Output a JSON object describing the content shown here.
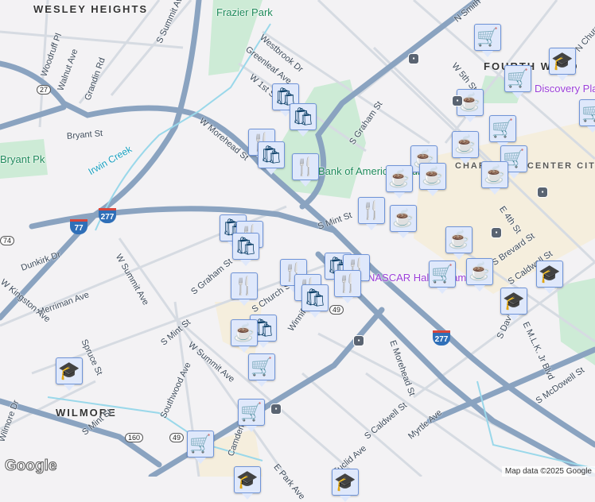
{
  "areas": {
    "wesley_heights": "WESLEY HEIGHTS",
    "wilmore": "WILMORE",
    "fourth_ward": "FOURTH WARD",
    "center_city": "CHARLOTTE CENTER CITY"
  },
  "parks": {
    "frazier": "Frazier Park",
    "bryant": "Bryant Pk",
    "bank_of_america": "Bank of America Stadium"
  },
  "pois": {
    "discovery": "Discovery Place",
    "nascar": "NASCAR Hall of Fame"
  },
  "water": {
    "irwin_creek": "Irwin Creek"
  },
  "streets": [
    "Woodruff Pl",
    "Walnut Ave",
    "Grandin Rd",
    "S Summit Ave",
    "Westbrook Dr",
    "Greenleaf Ave",
    "W 1st St",
    "W Morehead St",
    "Bryant St",
    "S Graham St",
    "W 5th St",
    "N Smith St",
    "N Church St",
    "S Mint St",
    "E 4th St",
    "S Brevard St",
    "S Caldwell St",
    "S Davidson St",
    "E M.L.K. Jr Blvd",
    "S McDowell St",
    "E Morehead St",
    "Myrtle Ave",
    "Euclid Ave",
    "S Caldwell St",
    "W Summit Ave",
    "S Graham St",
    "S Church St",
    "Winnifred St",
    "Dunkirk Dr",
    "Merriman Ave",
    "W Kingston Ave",
    "Spruce St",
    "S Mint St",
    "Southwood Ave",
    "W Summit Ave",
    "Wilmore Dr",
    "Camden Rd",
    "E Park Ave",
    "S Mint St"
  ],
  "shields": {
    "i277a": "277",
    "i77": "77",
    "i277b": "277",
    "us74": "74",
    "nc27": "27",
    "nc49a": "49",
    "nc49b": "49",
    "nc160": "160"
  },
  "markers": [
    "shop",
    "shop",
    "restaurant",
    "shop",
    "restaurant",
    "grocery",
    "grocery",
    "school",
    "coffee",
    "grocery",
    "grocery",
    "coffee",
    "grocery",
    "coffee",
    "coffee",
    "coffee",
    "coffee",
    "restaurant",
    "coffee",
    "coffee",
    "shop",
    "restaurant",
    "shop",
    "restaurant",
    "shop",
    "restaurant",
    "restaurant",
    "restaurant",
    "shop",
    "restaurant",
    "shop",
    "coffee",
    "grocery",
    "coffee",
    "school",
    "school",
    "school",
    "grocery",
    "grocery",
    "grocery",
    "school",
    "school"
  ],
  "icons": {
    "shop": "🛍",
    "restaurant": "🍴",
    "grocery": "🛒",
    "coffee": "☕",
    "school": "🎓"
  },
  "footer": {
    "logo": "Google",
    "attribution": "Map data ©2025 Google"
  }
}
